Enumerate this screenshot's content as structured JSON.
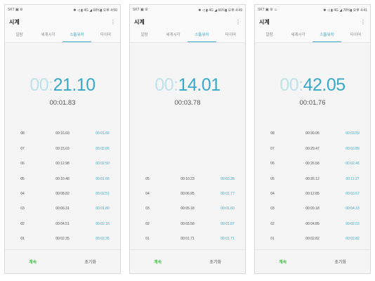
{
  "tabs": [
    "알람",
    "세계시각",
    "스톱워치",
    "타이머"
  ],
  "app_title": "시계",
  "buttons": {
    "continue": "계속",
    "reset": "초기화"
  },
  "colors": {
    "accent": "#3aa9c7",
    "continue": "#3cc13c"
  },
  "icons": {
    "menu": "more-vert-icon"
  },
  "screens": [
    {
      "status_left": "SKT ▣ ⚙",
      "status_right": "✱ ◁ ▮ 4G ◢ 68%▮ 오후 4:50",
      "main_dim": "00:",
      "main_bright": "21.10",
      "lap_time": "00:01.83",
      "laps": [
        {
          "num": "08",
          "total": "00:16.69",
          "split": "00:01.66"
        },
        {
          "num": "07",
          "total": "00:15.03",
          "split": "00:02.05"
        },
        {
          "num": "06",
          "total": "00:12.98",
          "split": "00:02.50"
        },
        {
          "num": "05",
          "total": "00:10.48",
          "split": "00:01.66"
        },
        {
          "num": "04",
          "total": "00:08.82",
          "split": "00:02.51"
        },
        {
          "num": "03",
          "total": "00:06.31",
          "split": "00:01.80"
        },
        {
          "num": "02",
          "total": "00:04.51",
          "split": "00:02.16"
        },
        {
          "num": "01",
          "total": "00:02.35",
          "split": "00:02.35"
        }
      ]
    },
    {
      "status_left": "SKT ▣ ⚙",
      "status_right": "✱ ◁ ▮ 4G ◢ 66%▮ 오후 4:49",
      "main_dim": "00:",
      "main_bright": "14.01",
      "lap_time": "00:03.78",
      "laps": [
        {
          "num": "05",
          "total": "00:10.23",
          "split": "00:03.28"
        },
        {
          "num": "04",
          "total": "00:06.95",
          "split": "00:01.77"
        },
        {
          "num": "03",
          "total": "00:05.18",
          "split": "00:01.60"
        },
        {
          "num": "02",
          "total": "00:03.58",
          "split": "00:01.87"
        },
        {
          "num": "01",
          "total": "00:01.71",
          "split": "00:01.71"
        }
      ]
    },
    {
      "status_left": "SKT ▣ ⚙ ☺",
      "status_right": "✱ ◁ ▮ 4G ◢ 78%▮ 오후 4:41",
      "main_dim": "00:",
      "main_bright": "42.05",
      "lap_time": "00:01.76",
      "laps": [
        {
          "num": "08",
          "total": "00:30.06",
          "split": "00:03.59"
        },
        {
          "num": "07",
          "total": "00:29.47",
          "split": "00:03.89"
        },
        {
          "num": "06",
          "total": "00:26.58",
          "split": "00:02.46"
        },
        {
          "num": "05",
          "total": "00:26.12",
          "split": "00:11.27"
        },
        {
          "num": "04",
          "total": "00:12.85",
          "split": "00:03.67"
        },
        {
          "num": "03",
          "total": "00:09.18",
          "split": "00:04.33"
        },
        {
          "num": "02",
          "total": "00:04.85",
          "split": "00:02.03"
        },
        {
          "num": "01",
          "total": "00:02.82",
          "split": "00:02.82"
        }
      ]
    }
  ]
}
